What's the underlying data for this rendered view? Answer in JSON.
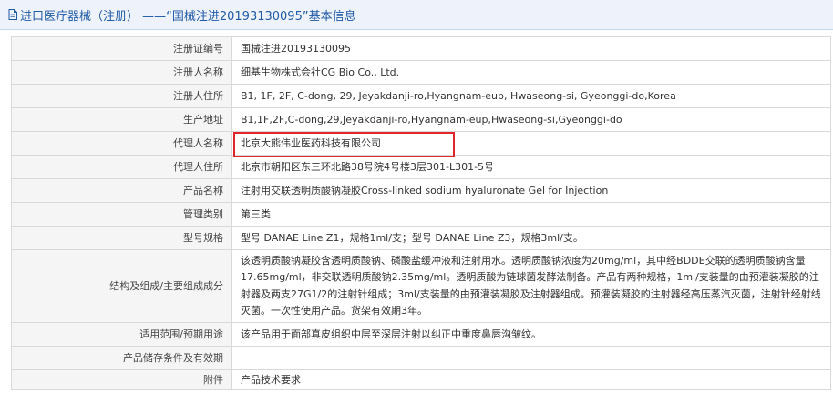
{
  "header": {
    "title": "进口医疗器械（注册） ——“国械注进20193130095”基本信息"
  },
  "table": {
    "rows": [
      {
        "label": "注册证编号",
        "value": "国械注进20193130095"
      },
      {
        "label": "注册人名称",
        "value": "细基生物株式会社CG Bio Co., Ltd."
      },
      {
        "label": "注册人住所",
        "value": "B1, 1F, 2F, C-dong, 29, Jeyakdanji-ro,Hyangnam-eup, Hwaseong-si, Gyeonggi-do,Korea"
      },
      {
        "label": "生产地址",
        "value": "B1,1F,2F,C-dong,29,Jeyakdanji-ro,Hyangnam-eup,Hwaseong-si,Gyeonggi-do"
      },
      {
        "label": "代理人名称",
        "value": "北京大熊伟业医药科技有限公司"
      },
      {
        "label": "代理人住所",
        "value": "北京市朝阳区东三环北路38号院4号楼3层301-L301-5号"
      },
      {
        "label": "产品名称",
        "value": "注射用交联透明质酸钠凝胶Cross-linked sodium hyaluronate Gel for Injection"
      },
      {
        "label": "管理类别",
        "value": "第三类"
      },
      {
        "label": "型号规格",
        "value": "型号 DANAE Line Z1，规格1ml/支；型号 DANAE Line Z3，规格3ml/支。"
      },
      {
        "label": "结构及组成/主要组成成分",
        "value": "该透明质酸钠凝胶含透明质酸钠、磷酸盐缓冲液和注射用水。透明质酸钠浓度为20mg/ml，其中经BDDE交联的透明质酸钠含量17.65mg/ml，非交联透明质酸钠2.35mg/ml。透明质酸为链球菌发酵法制备。产品有两种规格，1ml/支装量的由预灌装凝胶的注射器及两支27G1/2的注射针组成；3ml/支装量的由预灌装凝胶及注射器组成。预灌装凝胶的注射器经高压蒸汽灭菌，注射针经射线灭菌。一次性使用产品。货架有效期3年。"
      },
      {
        "label": "适用范围/预期用途",
        "value": "该产品用于面部真皮组织中层至深层注射以纠正中重度鼻唇沟皱纹。"
      },
      {
        "label": "产品储存条件及有效期",
        "value": ""
      },
      {
        "label": "附件",
        "value": "产品技术要求"
      }
    ]
  },
  "colors": {
    "header_text": "#1f5aa6",
    "header_bg": "#eef3fb",
    "label_bg": "#f5f5f5",
    "highlight": "#e0262a"
  },
  "icons": {
    "header_icon": "document-icon"
  }
}
